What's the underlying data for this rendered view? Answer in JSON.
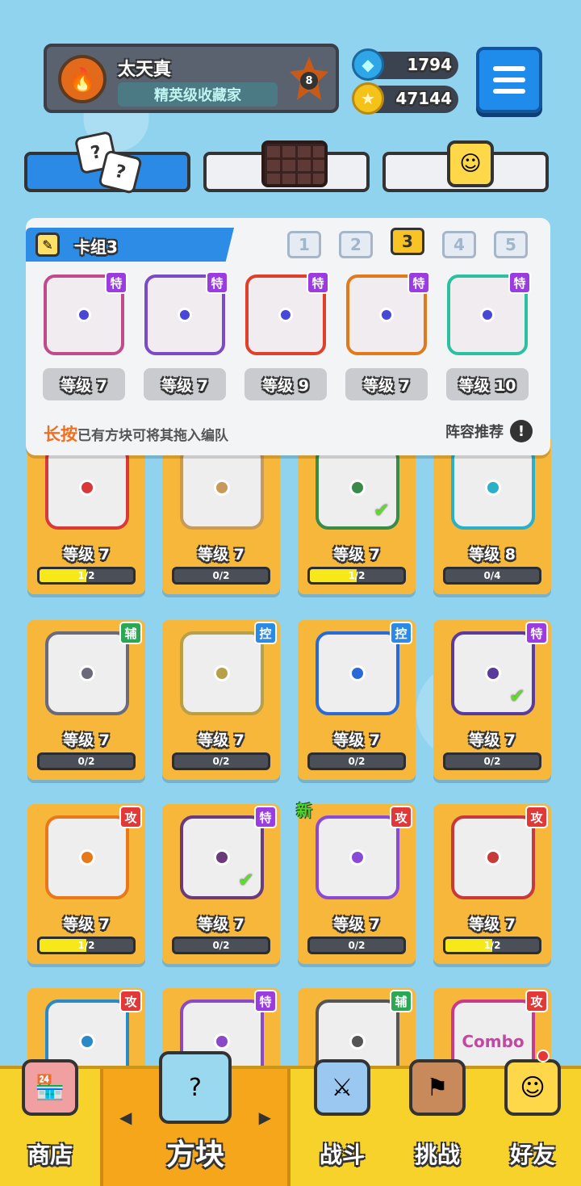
{
  "player": {
    "name": "太天真",
    "title": "精英级收藏家",
    "rank": "8"
  },
  "currency": {
    "gems": "1794",
    "coins": "47144"
  },
  "deck": {
    "name": "卡组3",
    "numbers": [
      "1",
      "2",
      "3",
      "4",
      "5"
    ],
    "active": "3",
    "cards": [
      {
        "tag": "特",
        "level": "等级 7",
        "color": "#c04a8a"
      },
      {
        "tag": "特",
        "level": "等级 7",
        "color": "#7a4ac8"
      },
      {
        "tag": "特",
        "level": "等级 9",
        "color": "#e0402a"
      },
      {
        "tag": "特",
        "level": "等级 7",
        "color": "#e07a1a"
      },
      {
        "tag": "特",
        "level": "等级 10",
        "color": "#2ac0a0"
      }
    ],
    "hint_em": "长按",
    "hint": "已有方块可将其拖入编队",
    "recommend": "阵容推荐"
  },
  "grid": [
    {
      "level": "等级 7",
      "progress": "1/2",
      "fill": 0.5,
      "tag": "",
      "color": "#d83a3a",
      "check": false,
      "new": false
    },
    {
      "level": "等级 7",
      "progress": "0/2",
      "fill": 0,
      "tag": "",
      "color": "#c89a5a",
      "check": false,
      "new": false
    },
    {
      "level": "等级 7",
      "progress": "1/2",
      "fill": 0.5,
      "tag": "",
      "color": "#3a8a4a",
      "check": true,
      "new": false
    },
    {
      "level": "等级 8",
      "progress": "0/4",
      "fill": 0,
      "tag": "",
      "color": "#2ab0c8",
      "check": false,
      "new": false
    },
    {
      "level": "等级 7",
      "progress": "0/2",
      "fill": 0,
      "tag": "辅",
      "color": "#6a6a7a",
      "check": false,
      "new": false
    },
    {
      "level": "等级 7",
      "progress": "0/2",
      "fill": 0,
      "tag": "控",
      "color": "#b8a048",
      "check": false,
      "new": false
    },
    {
      "level": "等级 7",
      "progress": "0/2",
      "fill": 0,
      "tag": "控",
      "color": "#2a6ad8",
      "check": false,
      "new": false
    },
    {
      "level": "等级 7",
      "progress": "0/2",
      "fill": 0,
      "tag": "特",
      "color": "#5a3a9a",
      "check": true,
      "new": false
    },
    {
      "level": "等级 7",
      "progress": "1/2",
      "fill": 0.5,
      "tag": "攻",
      "color": "#e8781a",
      "check": false,
      "new": false
    },
    {
      "level": "等级 7",
      "progress": "0/2",
      "fill": 0,
      "tag": "特",
      "color": "#6a3a7a",
      "check": true,
      "new": false
    },
    {
      "level": "等级 7",
      "progress": "0/2",
      "fill": 0,
      "tag": "攻",
      "color": "#8a4ad8",
      "check": false,
      "new": true,
      "new_label": "新"
    },
    {
      "level": "等级 7",
      "progress": "1/2",
      "fill": 0.5,
      "tag": "攻",
      "color": "#c83a3a",
      "check": false,
      "new": false
    },
    {
      "level": "",
      "progress": "",
      "fill": 0,
      "tag": "攻",
      "color": "#2a8ac8",
      "check": false,
      "new": false
    },
    {
      "level": "",
      "progress": "",
      "fill": 0,
      "tag": "特",
      "color": "#8a4ac8",
      "check": false,
      "new": false
    },
    {
      "level": "",
      "progress": "",
      "fill": 0,
      "tag": "辅",
      "color": "#555",
      "check": false,
      "new": false
    },
    {
      "level": "",
      "progress": "",
      "fill": 0,
      "tag": "攻",
      "color": "#c83a8a",
      "check": false,
      "new": false,
      "art_text": "Combo"
    }
  ],
  "nav": {
    "shop": "商店",
    "blocks": "方块",
    "battle": "战斗",
    "challenge": "挑战",
    "friends": "好友"
  },
  "colors": {
    "accent_blue": "#2d8ce6",
    "card_gold": "#f6b73a",
    "nav_yellow": "#f7d22a"
  }
}
